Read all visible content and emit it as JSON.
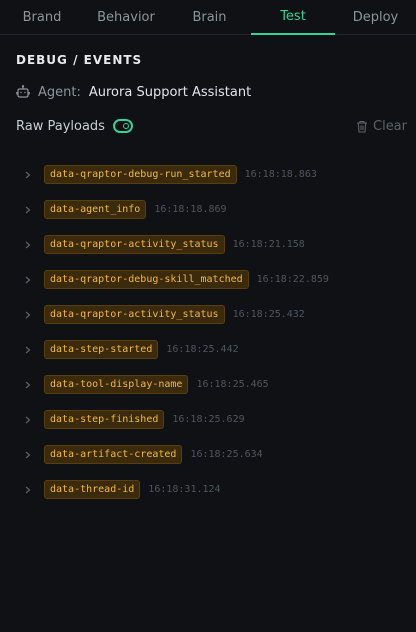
{
  "tabs": [
    {
      "label": "Brand",
      "active": false
    },
    {
      "label": "Behavior",
      "active": false
    },
    {
      "label": "Brain",
      "active": false
    },
    {
      "label": "Test",
      "active": true
    },
    {
      "label": "Deploy",
      "active": false
    }
  ],
  "section": {
    "title": "DEBUG / EVENTS"
  },
  "agent": {
    "label": "Agent:",
    "value": "Aurora Support Assistant",
    "icon": "bot-icon"
  },
  "raw_payloads": {
    "label": "Raw Payloads",
    "enabled": true
  },
  "clear": {
    "label": "Clear",
    "icon": "trash-icon"
  },
  "events": [
    {
      "name": "data-qraptor-debug-run_started",
      "time": "16:18:18.863"
    },
    {
      "name": "data-agent_info",
      "time": "16:18:18.869"
    },
    {
      "name": "data-qraptor-activity_status",
      "time": "16:18:21.158"
    },
    {
      "name": "data-qraptor-debug-skill_matched",
      "time": "16:18:22.859"
    },
    {
      "name": "data-qraptor-activity_status",
      "time": "16:18:25.432"
    },
    {
      "name": "data-step-started",
      "time": "16:18:25.442"
    },
    {
      "name": "data-tool-display-name",
      "time": "16:18:25.465"
    },
    {
      "name": "data-step-finished",
      "time": "16:18:25.629"
    },
    {
      "name": "data-artifact-created",
      "time": "16:18:25.634"
    },
    {
      "name": "data-thread-id",
      "time": "16:18:31.124"
    }
  ],
  "colors": {
    "accent": "#34d399",
    "event_tag_text": "#f4b942",
    "event_tag_bg": "#3b2a0c",
    "background": "#0f1115"
  }
}
